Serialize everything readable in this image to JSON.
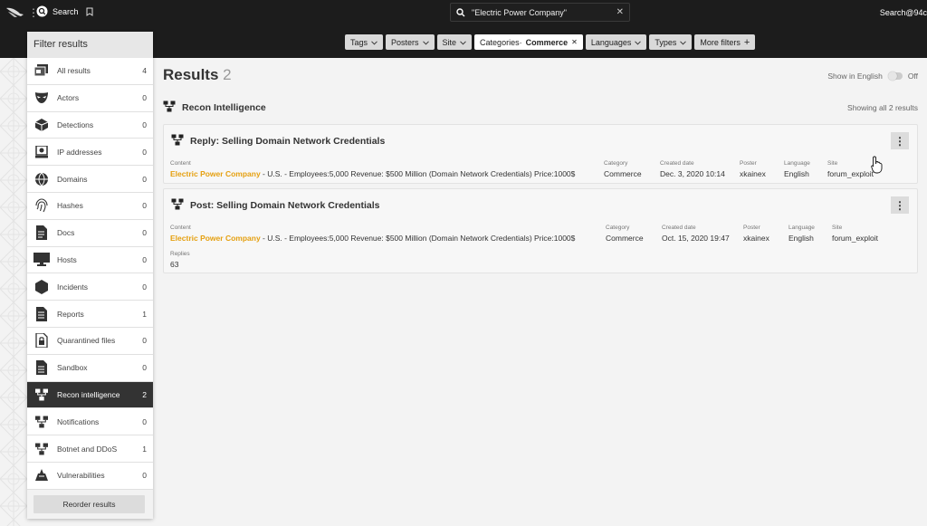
{
  "topbar": {
    "search_label": "Search",
    "query": "\"Electric Power Company\"",
    "user": "Search@94c"
  },
  "filters": [
    {
      "label": "Tags",
      "value": "",
      "active": false,
      "icon": "chevron-down"
    },
    {
      "label": "Posters",
      "value": "",
      "active": false,
      "icon": "chevron-down"
    },
    {
      "label": "Site",
      "value": "",
      "active": false,
      "icon": "chevron-down"
    },
    {
      "label": "Categories·",
      "value": "Commerce",
      "active": true,
      "icon": "close"
    },
    {
      "label": "Languages",
      "value": "",
      "active": false,
      "icon": "chevron-down"
    },
    {
      "label": "Types",
      "value": "",
      "active": false,
      "icon": "chevron-down"
    },
    {
      "label": "More filters",
      "value": "",
      "active": false,
      "icon": "plus"
    }
  ],
  "panel": {
    "title": "Filter results",
    "reorder_label": "Reorder results",
    "items": [
      {
        "label": "All results",
        "count": "4",
        "icon": "all-results-icon"
      },
      {
        "label": "Actors",
        "count": "0",
        "icon": "actor-mask-icon"
      },
      {
        "label": "Detections",
        "count": "0",
        "icon": "detections-icon"
      },
      {
        "label": "IP addresses",
        "count": "0",
        "icon": "ip-address-icon"
      },
      {
        "label": "Domains",
        "count": "0",
        "icon": "globe-icon"
      },
      {
        "label": "Hashes",
        "count": "0",
        "icon": "fingerprint-icon"
      },
      {
        "label": "Docs",
        "count": "0",
        "icon": "document-icon"
      },
      {
        "label": "Hosts",
        "count": "0",
        "icon": "monitor-icon"
      },
      {
        "label": "Incidents",
        "count": "0",
        "icon": "hexagon-icon"
      },
      {
        "label": "Reports",
        "count": "1",
        "icon": "report-icon"
      },
      {
        "label": "Quarantined files",
        "count": "0",
        "icon": "lock-file-icon"
      },
      {
        "label": "Sandbox",
        "count": "0",
        "icon": "sandbox-icon"
      },
      {
        "label": "Recon intelligence",
        "count": "2",
        "icon": "network-icon",
        "selected": true
      },
      {
        "label": "Notifications",
        "count": "0",
        "icon": "network-icon"
      },
      {
        "label": "Botnet and DDoS",
        "count": "1",
        "icon": "network-icon"
      },
      {
        "label": "Vulnerabilities",
        "count": "0",
        "icon": "vulnerability-icon"
      }
    ]
  },
  "main": {
    "title": "Results",
    "count": "2",
    "show_english": "Show in English",
    "toggle_state": "Off",
    "section": "Recon Intelligence",
    "showing": "Showing all 2 results",
    "labels": {
      "content": "Content",
      "category": "Category",
      "created": "Created date",
      "poster": "Poster",
      "language": "Language",
      "site": "Site",
      "replies": "Replies"
    },
    "cards": [
      {
        "title": "Reply: Selling Domain Network Credentials",
        "highlight": "Electric Power Company",
        "content": " - U.S. - Employees:5,000   Revenue: $500 Million  (Domain Network Credentials)     Price:1000$",
        "category": "Commerce",
        "created": "Dec. 3, 2020 10:14",
        "poster": "xkainex",
        "language": "English",
        "site": "forum_exploit"
      },
      {
        "title": "Post: Selling Domain Network Credentials",
        "highlight": "Electric Power Company",
        "content": " - U.S. - Employees:5,000   Revenue: $500 Million   (Domain Network Credentials)     Price:1000$",
        "category": "Commerce",
        "created": "Oct. 15, 2020 19:47",
        "poster": "xkainex",
        "language": "English",
        "site": "forum_exploit",
        "replies": "63"
      }
    ]
  }
}
